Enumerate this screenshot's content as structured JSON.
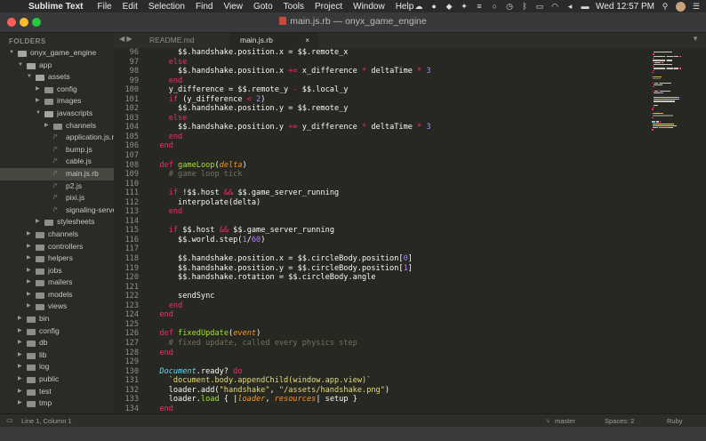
{
  "menubar": {
    "app_name": "Sublime Text",
    "items": [
      "File",
      "Edit",
      "Selection",
      "Find",
      "View",
      "Goto",
      "Tools",
      "Project",
      "Window",
      "Help"
    ],
    "clock": "Wed 12:57 PM"
  },
  "window": {
    "title": "main.js.rb — onyx_game_engine"
  },
  "sidebar": {
    "header": "FOLDERS",
    "rows": [
      {
        "label": "onyx_game_engine",
        "type": "folder",
        "open": true,
        "depth": 0
      },
      {
        "label": "app",
        "type": "folder",
        "open": true,
        "depth": 1
      },
      {
        "label": "assets",
        "type": "folder",
        "open": true,
        "depth": 2
      },
      {
        "label": "config",
        "type": "folder",
        "open": false,
        "depth": 3
      },
      {
        "label": "images",
        "type": "folder",
        "open": false,
        "depth": 3
      },
      {
        "label": "javascripts",
        "type": "folder",
        "open": true,
        "depth": 3
      },
      {
        "label": "channels",
        "type": "folder",
        "open": false,
        "depth": 4
      },
      {
        "label": "application.js.rb",
        "type": "file",
        "depth": 4
      },
      {
        "label": "bump.js",
        "type": "file",
        "depth": 4
      },
      {
        "label": "cable.js",
        "type": "file",
        "depth": 4
      },
      {
        "label": "main.js.rb",
        "type": "file",
        "depth": 4,
        "selected": true
      },
      {
        "label": "p2.js",
        "type": "file",
        "depth": 4
      },
      {
        "label": "pixi.js",
        "type": "file",
        "depth": 4
      },
      {
        "label": "signaling-server.js",
        "type": "file",
        "depth": 4
      },
      {
        "label": "stylesheets",
        "type": "folder",
        "open": false,
        "depth": 3
      },
      {
        "label": "channels",
        "type": "folder",
        "open": false,
        "depth": 2
      },
      {
        "label": "controllers",
        "type": "folder",
        "open": false,
        "depth": 2
      },
      {
        "label": "helpers",
        "type": "folder",
        "open": false,
        "depth": 2
      },
      {
        "label": "jobs",
        "type": "folder",
        "open": false,
        "depth": 2
      },
      {
        "label": "mailers",
        "type": "folder",
        "open": false,
        "depth": 2
      },
      {
        "label": "models",
        "type": "folder",
        "open": false,
        "depth": 2
      },
      {
        "label": "views",
        "type": "folder",
        "open": false,
        "depth": 2
      },
      {
        "label": "bin",
        "type": "folder",
        "open": false,
        "depth": 1
      },
      {
        "label": "config",
        "type": "folder",
        "open": false,
        "depth": 1
      },
      {
        "label": "db",
        "type": "folder",
        "open": false,
        "depth": 1
      },
      {
        "label": "lib",
        "type": "folder",
        "open": false,
        "depth": 1
      },
      {
        "label": "log",
        "type": "folder",
        "open": false,
        "depth": 1
      },
      {
        "label": "public",
        "type": "folder",
        "open": false,
        "depth": 1
      },
      {
        "label": "test",
        "type": "folder",
        "open": false,
        "depth": 1
      },
      {
        "label": "tmp",
        "type": "folder",
        "open": false,
        "depth": 1
      }
    ]
  },
  "tabs": [
    {
      "label": "README.md",
      "close": "×",
      "active": false
    },
    {
      "label": "main.js.rb",
      "close": "×",
      "active": true
    }
  ],
  "editor": {
    "first_line": 96,
    "lines": [
      [
        [
          "      $$.handshake.position.x = $$.remote_x",
          ""
        ]
      ],
      [
        [
          "    ",
          ""
        ],
        [
          "else",
          "kw"
        ]
      ],
      [
        [
          "      $$.handshake.position.x ",
          ""
        ],
        [
          "+=",
          "kw"
        ],
        [
          " x_difference ",
          ""
        ],
        [
          "*",
          "kw"
        ],
        [
          " deltaTime ",
          ""
        ],
        [
          "*",
          "kw"
        ],
        [
          " ",
          ""
        ],
        [
          "3",
          "num"
        ]
      ],
      [
        [
          "    ",
          ""
        ],
        [
          "end",
          "kw"
        ]
      ],
      [
        [
          "    y_difference = $$.remote_y ",
          ""
        ],
        [
          "-",
          "kw"
        ],
        [
          " $$.local_y",
          ""
        ]
      ],
      [
        [
          "    ",
          ""
        ],
        [
          "if",
          "kw"
        ],
        [
          " (y_difference ",
          ""
        ],
        [
          "<",
          "kw"
        ],
        [
          " ",
          ""
        ],
        [
          "2",
          "num"
        ],
        [
          ")",
          ""
        ]
      ],
      [
        [
          "      $$.handshake.position.y = $$.remote_y",
          ""
        ]
      ],
      [
        [
          "    ",
          ""
        ],
        [
          "else",
          "kw"
        ]
      ],
      [
        [
          "      $$.handshake.position.y ",
          ""
        ],
        [
          "+=",
          "kw"
        ],
        [
          " y_difference ",
          ""
        ],
        [
          "*",
          "kw"
        ],
        [
          " deltaTime ",
          ""
        ],
        [
          "*",
          "kw"
        ],
        [
          " ",
          ""
        ],
        [
          "3",
          "num"
        ]
      ],
      [
        [
          "    ",
          ""
        ],
        [
          "end",
          "kw"
        ]
      ],
      [
        [
          "  ",
          ""
        ],
        [
          "end",
          "kw"
        ]
      ],
      [
        [
          "",
          ""
        ]
      ],
      [
        [
          "  ",
          ""
        ],
        [
          "def",
          "kw"
        ],
        [
          " ",
          ""
        ],
        [
          "gameLoop",
          "fn"
        ],
        [
          "(",
          ""
        ],
        [
          "delta",
          "prm"
        ],
        [
          ")",
          ""
        ]
      ],
      [
        [
          "    ",
          ""
        ],
        [
          "# game loop tick",
          "cm"
        ]
      ],
      [
        [
          "",
          ""
        ]
      ],
      [
        [
          "    ",
          ""
        ],
        [
          "if",
          "kw"
        ],
        [
          " !$$.host ",
          ""
        ],
        [
          "&&",
          "kw"
        ],
        [
          " $$.game_server_running",
          ""
        ]
      ],
      [
        [
          "      interpolate(delta)",
          ""
        ]
      ],
      [
        [
          "    ",
          ""
        ],
        [
          "end",
          "kw"
        ]
      ],
      [
        [
          "",
          ""
        ]
      ],
      [
        [
          "    ",
          ""
        ],
        [
          "if",
          "kw"
        ],
        [
          " $$.host ",
          ""
        ],
        [
          "&&",
          "kw"
        ],
        [
          " $$.game_server_running",
          ""
        ]
      ],
      [
        [
          "      $$.world.step(",
          ""
        ],
        [
          "1",
          "num"
        ],
        [
          "/",
          ""
        ],
        [
          "60",
          "num"
        ],
        [
          ")",
          ""
        ]
      ],
      [
        [
          "",
          ""
        ]
      ],
      [
        [
          "      $$.handshake.position.x = $$.circleBody.position[",
          ""
        ],
        [
          "0",
          "num"
        ],
        [
          "]",
          ""
        ]
      ],
      [
        [
          "      $$.handshake.position.y = $$.circleBody.position[",
          ""
        ],
        [
          "1",
          "num"
        ],
        [
          "]",
          ""
        ]
      ],
      [
        [
          "      $$.handshake.rotation = $$.circleBody.angle",
          ""
        ]
      ],
      [
        [
          "",
          ""
        ]
      ],
      [
        [
          "      sendSync",
          ""
        ]
      ],
      [
        [
          "    ",
          ""
        ],
        [
          "end",
          "kw"
        ]
      ],
      [
        [
          "  ",
          ""
        ],
        [
          "end",
          "kw"
        ]
      ],
      [
        [
          "",
          ""
        ]
      ],
      [
        [
          "  ",
          ""
        ],
        [
          "def",
          "kw"
        ],
        [
          " ",
          ""
        ],
        [
          "fixedUpdate",
          "fn"
        ],
        [
          "(",
          ""
        ],
        [
          "event",
          "prm"
        ],
        [
          ")",
          ""
        ]
      ],
      [
        [
          "    ",
          ""
        ],
        [
          "# fixed update, called every physics step",
          "cm"
        ]
      ],
      [
        [
          "  ",
          ""
        ],
        [
          "end",
          "kw"
        ]
      ],
      [
        [
          "",
          ""
        ]
      ],
      [
        [
          "  ",
          ""
        ],
        [
          "Document",
          "cls"
        ],
        [
          ".ready? ",
          ""
        ],
        [
          "do",
          "kw"
        ]
      ],
      [
        [
          "    ",
          ""
        ],
        [
          "`document.body.appendChild(window.app.view)`",
          "str"
        ]
      ],
      [
        [
          "    loader.add(",
          ""
        ],
        [
          "\"handshake\"",
          "str"
        ],
        [
          ", ",
          ""
        ],
        [
          "\"/assets/handshake.png\"",
          "str"
        ],
        [
          ")",
          ""
        ]
      ],
      [
        [
          "    loader.",
          ""
        ],
        [
          "load",
          "fn"
        ],
        [
          " { |",
          ""
        ],
        [
          "loader",
          "prm"
        ],
        [
          ", ",
          ""
        ],
        [
          "resources",
          "prm"
        ],
        [
          "| setup }",
          ""
        ]
      ],
      [
        [
          "  ",
          ""
        ],
        [
          "end",
          "kw"
        ]
      ]
    ]
  },
  "statusbar": {
    "position": "Line 1, Column 1",
    "branch": "master",
    "indent": "Spaces: 2",
    "syntax": "Ruby"
  },
  "icons": [
    "apple-icon",
    "cloud-icon",
    "wifi-icon",
    "battery-icon",
    "volume-icon",
    "bluetooth-icon",
    "search-icon",
    "list-icon",
    "branch-icon"
  ]
}
